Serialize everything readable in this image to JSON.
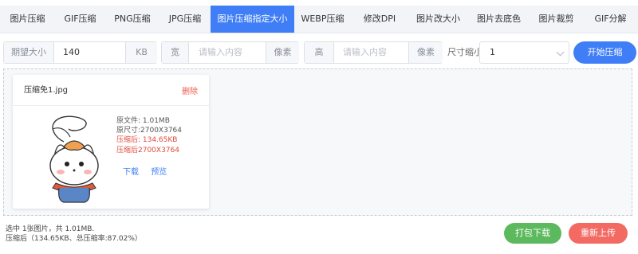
{
  "tabs": [
    {
      "label": "图片压缩"
    },
    {
      "label": "GIF压缩"
    },
    {
      "label": "PNG压缩"
    },
    {
      "label": "JPG压缩"
    },
    {
      "label": "图片压缩指定大小"
    },
    {
      "label": "WEBP压缩"
    },
    {
      "label": "修改DPI"
    },
    {
      "label": "图片改大小"
    },
    {
      "label": "图片去底色"
    },
    {
      "label": "图片裁剪"
    },
    {
      "label": "GIF分解"
    }
  ],
  "controls": {
    "target_size_label": "期望大小",
    "target_size_value": "140",
    "target_size_unit": "KB",
    "width_label": "宽",
    "width_placeholder": "请输入内容",
    "width_unit": "像素",
    "height_label": "高",
    "height_placeholder": "请输入内容",
    "height_unit": "像素",
    "scale_label": "尺寸缩小",
    "scale_value": "1",
    "start_button": "开始压缩"
  },
  "file": {
    "name": "压缩免1.jpg",
    "delete_label": "删除",
    "original_size": "原文件: 1.01MB",
    "original_dims": "原尺寸:2700X3764",
    "compressed_size": "压缩后: 134.65KB",
    "compressed_dims": "压缩后2700X3764",
    "download_label": "下载",
    "preview_label": "预览"
  },
  "summary": {
    "line1": "选中 1张图片，共 1.01MB.",
    "line2": "压缩后（134.65KB、总压缩率:87.02%）"
  },
  "buttons": {
    "pack_download": "打包下载",
    "reupload": "重新上传"
  },
  "colors": {
    "accent": "#3f7ef6",
    "success": "#5db95d",
    "danger": "#f36a63",
    "error_text": "#e04b3c"
  }
}
